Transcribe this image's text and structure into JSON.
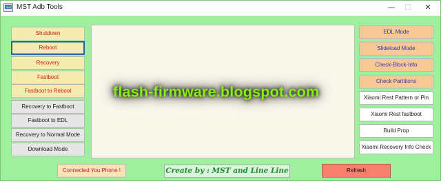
{
  "window": {
    "title": "MST Adb Tools",
    "minimize": "—",
    "maximize": "☐",
    "close": "✕"
  },
  "left_buttons": [
    {
      "label": "Shutdown"
    },
    {
      "label": "Reboot"
    },
    {
      "label": "Recovery"
    },
    {
      "label": "Fastboot"
    },
    {
      "label": "Fastboot to Reboot"
    },
    {
      "label": "Recovery to Fastboot"
    },
    {
      "label": "Fastboot to EDL"
    },
    {
      "label": "Recovery to Normal Mode"
    },
    {
      "label": "Download Mode"
    }
  ],
  "right_buttons": [
    {
      "label": "EDL Mode"
    },
    {
      "label": "Slideload Mode"
    },
    {
      "label": "Check-Block-Info"
    },
    {
      "label": "Check Partitions"
    },
    {
      "label": "Xiaomi Rest Pattern or Pin"
    },
    {
      "label": "Xiaomi Rest fastboot"
    },
    {
      "label": "Build Prop"
    },
    {
      "label": "Xiaomi Recovery Info Check"
    }
  ],
  "watermark": "flash-firmware.blogspot.com",
  "status_text": "Connected You Phone !",
  "credit_text": "Create by : MST and Line Line",
  "refresh_label": "Refresh",
  "colors": {
    "window_bg": "#9ef09c",
    "yellow_button": "#f5eab0",
    "orange_button": "#f8c994",
    "refresh_button": "#f77f6c",
    "watermark": "#88ee11"
  },
  "icons": [
    "app-icon",
    "minimize-icon",
    "maximize-icon",
    "close-icon"
  ]
}
